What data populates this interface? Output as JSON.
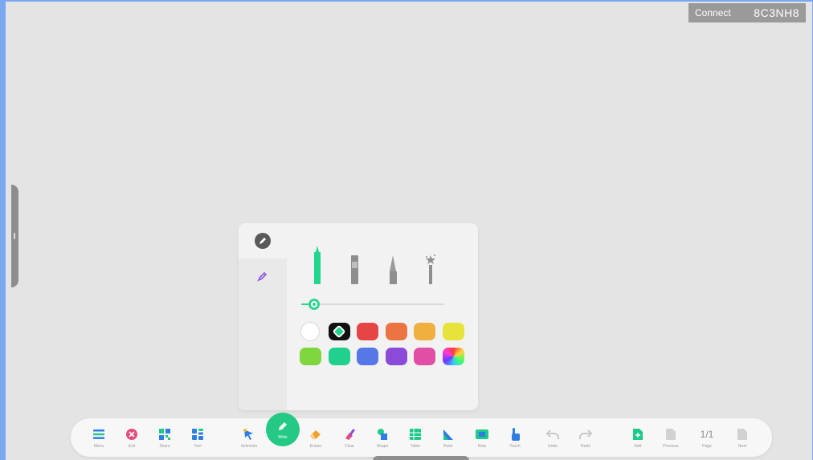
{
  "connect": {
    "label": "Connect",
    "code": "8C3NH8"
  },
  "pen_panel": {
    "tabs": [
      {
        "name": "pen",
        "icon": "pen-icon"
      },
      {
        "name": "highlighter",
        "icon": "highlighter-icon"
      }
    ],
    "pen_types": [
      "marker-pen",
      "chisel-pen",
      "brush-pen",
      "magic-pen"
    ],
    "size_level": 0.05,
    "colors": [
      "#ffffff",
      "#111111",
      "#e64545",
      "#ec7443",
      "#efb040",
      "#e8e33a",
      "#7fd63e",
      "#20d08d",
      "#5678e6",
      "#8b4bd8",
      "#e04ea5",
      "rainbow"
    ],
    "selected_color": "#20d08d"
  },
  "toolbar": {
    "items": [
      {
        "id": "menu",
        "label": "Menu",
        "icon": "menu-icon"
      },
      {
        "id": "exit",
        "label": "Exit",
        "icon": "close-circle-icon"
      },
      {
        "id": "share",
        "label": "Share",
        "icon": "share-qr-icon"
      },
      {
        "id": "tool",
        "label": "Tool",
        "icon": "apps-icon"
      },
      {
        "id": "selection",
        "label": "Selection",
        "icon": "cursor-icon"
      },
      {
        "id": "write",
        "label": "Write",
        "icon": "pen-icon"
      },
      {
        "id": "eraser",
        "label": "Eraser",
        "icon": "eraser-icon"
      },
      {
        "id": "clear",
        "label": "Clear",
        "icon": "broom-icon"
      },
      {
        "id": "shape",
        "label": "Shape",
        "icon": "shapes-icon"
      },
      {
        "id": "table",
        "label": "Table",
        "icon": "table-icon"
      },
      {
        "id": "ruler",
        "label": "Ruler",
        "icon": "ruler-icon"
      },
      {
        "id": "note",
        "label": "Note",
        "icon": "note-icon"
      },
      {
        "id": "touch",
        "label": "Touch",
        "icon": "hand-pointer-icon"
      },
      {
        "id": "undo",
        "label": "Undo",
        "icon": "undo-icon"
      },
      {
        "id": "redo",
        "label": "Redo",
        "icon": "redo-icon"
      },
      {
        "id": "add",
        "label": "Add",
        "icon": "add-page-icon"
      },
      {
        "id": "previous",
        "label": "Previous",
        "icon": "previous-page-icon"
      },
      {
        "id": "page",
        "label": "Page",
        "value": "1/1"
      },
      {
        "id": "next",
        "label": "Next",
        "icon": "next-page-icon"
      }
    ]
  }
}
